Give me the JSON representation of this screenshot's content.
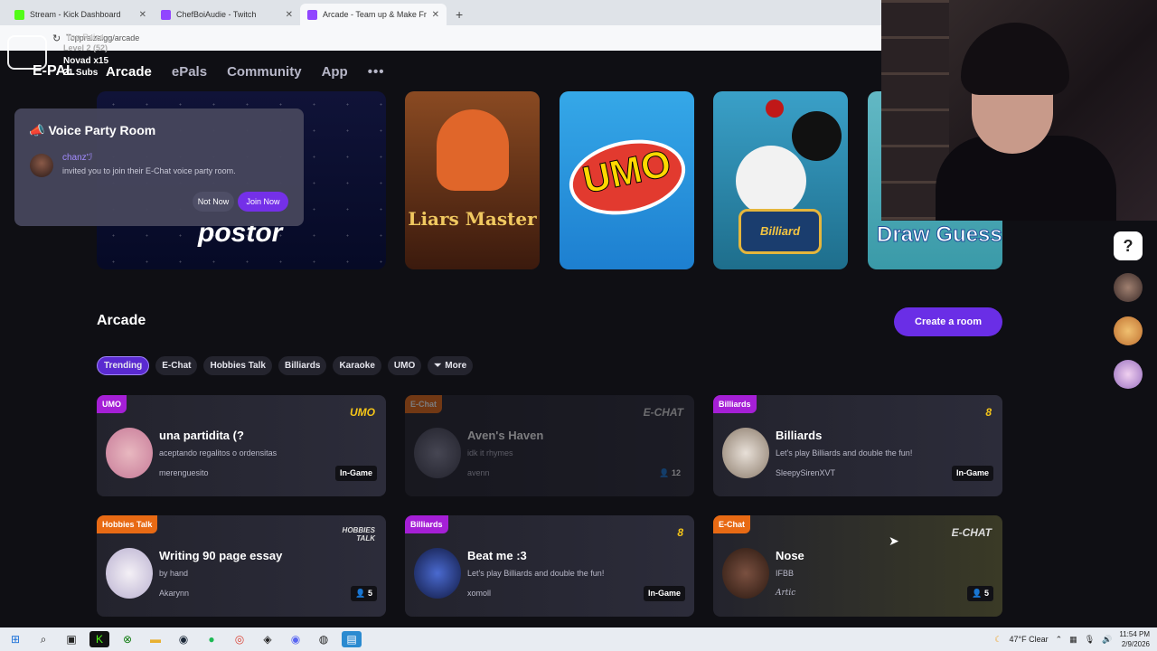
{
  "browser": {
    "tabs": [
      {
        "title": "Stream - Kick Dashboard",
        "color": "#53fc18"
      },
      {
        "title": "ChefBoiAudie - Twitch",
        "color": "#9146ff"
      },
      {
        "title": "Arcade - Team up & Make Frien",
        "color": "#9146ff"
      }
    ],
    "url": "Toppraizaigg/arcade"
  },
  "stream_overlay": {
    "line1": "Top Raiza",
    "line2": "Level 2 (52)",
    "line3": "Novad x15",
    "line4": "21 Subs"
  },
  "site": {
    "logo": "E-PAL",
    "nav": [
      "Arcade",
      "ePals",
      "Community",
      "App"
    ],
    "more": "•••"
  },
  "banners": {
    "impostor": "postor",
    "liars": "Liars Master",
    "umo": "UMO",
    "billiard": "Billiard",
    "draw": "Draw Guess"
  },
  "popup": {
    "title": "Voice Party Room",
    "user": "chanz'ℐ",
    "message": "invited you to join their E-Chat voice party room.",
    "not_now": "Not Now",
    "join_now": "Join Now"
  },
  "arcade": {
    "title": "Arcade",
    "create_room": "Create a room",
    "filters": [
      "Trending",
      "E-Chat",
      "Hobbies Talk",
      "Billiards",
      "Karaoke",
      "UMO"
    ],
    "more_filter": "More"
  },
  "rooms": [
    {
      "category": "UMO",
      "title": "una partidita (?",
      "desc": "aceptando regalitos o ordensitas",
      "host": "merenguesito",
      "status": "In-Game",
      "corner": "UMO"
    },
    {
      "category": "E-Chat",
      "title": "Aven's Haven",
      "desc": "idk it rhymes",
      "host": "avenn",
      "count": "12",
      "corner": "E-CHAT"
    },
    {
      "category": "Billiards",
      "title": "Billiards",
      "desc": "Let's play Billiards and double the fun!",
      "host": "SleepySirenXVT",
      "status": "In-Game",
      "corner": "8"
    },
    {
      "category": "Hobbies Talk",
      "title": "Writing 90 page essay",
      "desc": "by hand",
      "host": "Akarynn",
      "count": "5",
      "corner": "HOBBIES TALK"
    },
    {
      "category": "Billiards",
      "title": "Beat me :3",
      "desc": "Let's play Billiards and double the fun!",
      "host": "xomoll",
      "status": "In-Game",
      "corner": "8"
    },
    {
      "category": "E-Chat",
      "title": "Nose",
      "desc": "IFBB",
      "host": "Artic",
      "count": "5",
      "corner": "E-CHAT"
    }
  ],
  "taskbar": {
    "weather": "47°F  Clear",
    "time": "11:54 PM",
    "date": "2/9/2026"
  }
}
